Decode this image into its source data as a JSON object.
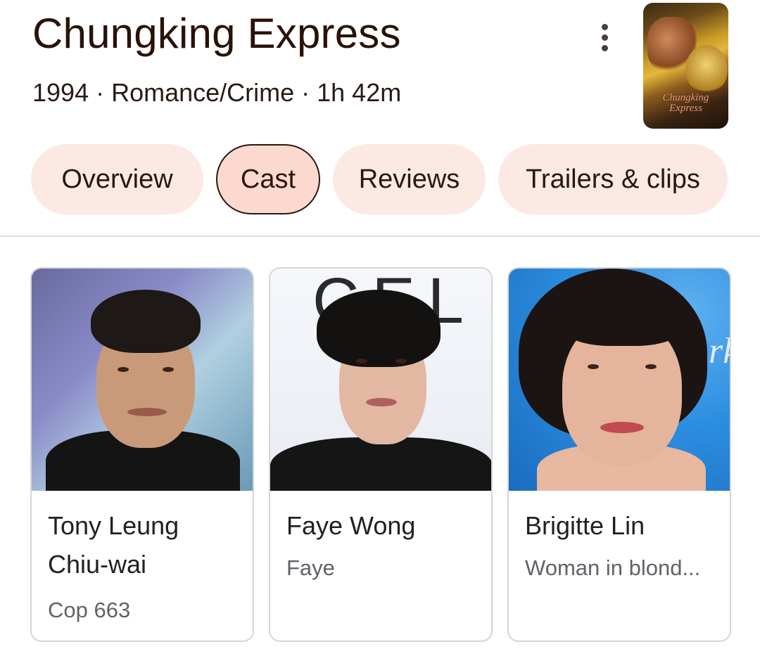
{
  "movie": {
    "title": "Chungking Express",
    "meta": "1994 · Romance/Crime · 1h 42m",
    "poster_text": "Chungking Express"
  },
  "menu": {
    "icon": "more-vert-icon"
  },
  "tabs": [
    {
      "label": "Overview",
      "active": false
    },
    {
      "label": "Cast",
      "active": true
    },
    {
      "label": "Reviews",
      "active": false
    },
    {
      "label": "Trailers & clips",
      "active": false
    }
  ],
  "cast": [
    {
      "name": "Tony Leung Chiu-wai",
      "role": "Cop 663"
    },
    {
      "name": "Faye Wong",
      "role": "Faye"
    },
    {
      "name": "Brigitte Lin",
      "role": "Woman in blond..."
    }
  ],
  "backdrop_text": {
    "chanel": "CEL",
    "blue_backdrop": "rk"
  },
  "colors": {
    "title": "#2a1208",
    "tab_bg": "#fce9e4",
    "tab_active_bg": "#fbd9cf",
    "role_text": "#5f6368"
  }
}
